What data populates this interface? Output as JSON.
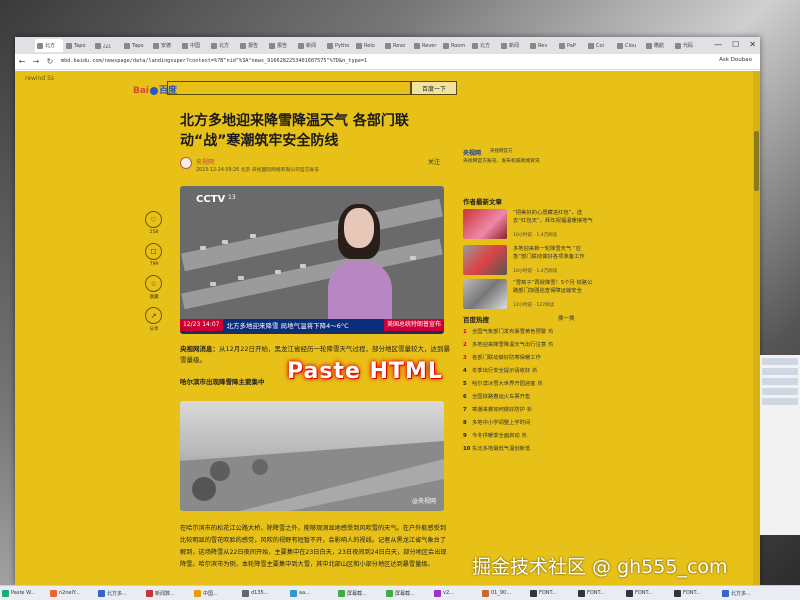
{
  "browser": {
    "tabs": [
      "北方",
      "Tapo",
      "¿¿¿",
      "Tapo",
      "安德",
      "中国",
      "北方",
      "报告",
      "报告",
      "新闻",
      "Pytho",
      "Relo",
      "Revo",
      "Rever",
      "Room",
      "北方",
      "新闻",
      "Rev",
      "PaP",
      "Coi",
      "Clou",
      "瞻航",
      "代码"
    ],
    "url": "mbd.baidu.com/newspage/data/landingsuper?context=%7B\"nid\"%3A\"news_9166282253401607575\"%7D&n_type=1",
    "ask_doubao": "Ask Doubao"
  },
  "page": {
    "rewind": "rewind 5s",
    "logo_text": "Bai",
    "logo_du": "百度",
    "search_button": "百度一下",
    "article": {
      "title": "北方多地迎来降雪降温天气 各部门联动“战”寒潮筑牢安全防线",
      "author": "央视网",
      "meta": "2023-12-24 09:26 北京 央视国际网络有限公司官方账号",
      "follow": "关注",
      "actions": [
        {
          "icon": "♡",
          "label": "258"
        },
        {
          "icon": "☐",
          "label": "799"
        },
        {
          "icon": "☆",
          "label": "收藏"
        },
        {
          "icon": "↗",
          "label": "分享"
        }
      ],
      "video": {
        "logo": "CCTV",
        "channel": "13",
        "ticker_time": "12/23 14:07",
        "ticker_text": "北方多地迎来降雪 局地气温将下降4～6°C",
        "ticker_right": "美国总统特朗普宣布"
      },
      "para1_lead": "央视网消息：",
      "para1": "从12月22日开始，黑龙江省经历一轮降雪天气过程，部分地区雪量较大，达到暴雪量级。",
      "subhead": "哈尔滨市出现降雪降主要集中",
      "image_watermark": "@央视网",
      "para2": "在哈尔滨市的松花江公路大桥，除降雪之外，能够观测显地感受到风吹雪的天气。在户外能感受到比较明显的雪花吹脸的感觉，风吹的视野有短暂不开，会影响人的视线。记者从黑龙江省气象台了解到，这场降雪从22日夜间开始，主要集中在23日白天，23日夜间到24日白天，部分地区会出现降雪。哈尔滨市为例，本轮降雪主要集中到大雪，其中北部山区和小部分地区达到暴雪量级。"
    },
    "sidebar": {
      "brand_name": "央视网",
      "brand_sub": "央视网官方",
      "brand_desc": "央视网官方账号，发布权威新闻资讯",
      "recent_title": "作者最新文章",
      "recent": [
        {
          "title": "“把美好的心愿藏进红包”，送去“红包天”，拜年祝福温暖接地气",
          "stats": "10小时前 · 1.4万阅读"
        },
        {
          "title": "多地迎来新一轮降雪天气 “应急”部门联动做好各项准备工作",
          "stats": "10小时前 · 1.4万阅读"
        },
        {
          "title": "“雪窝子”再掀降雪！5个月 铁路公路部门加强巡查保障运输安全",
          "stats": "12小时前 · 127阅读"
        }
      ],
      "hot_title": "百度热搜",
      "hot_refresh": "换一换",
      "hot": [
        {
          "n": "1",
          "text": "全国气象部门发布暴雪黄色预警",
          "badge": "热"
        },
        {
          "n": "2",
          "text": "多地迎来降雪降温天气出行注意",
          "badge": "热"
        },
        {
          "n": "3",
          "text": "各部门联动做好防寒保暖工作",
          "badge": ""
        },
        {
          "n": "4",
          "text": "冬季出行安全提示请收好",
          "badge": "新"
        },
        {
          "n": "5",
          "text": "哈尔滨冰雪大世界开园迎客",
          "badge": "热"
        },
        {
          "n": "6",
          "text": "全国铁路春运火车票开售",
          "badge": ""
        },
        {
          "n": "7",
          "text": "寒潮来袭如何做好防护",
          "badge": "新"
        },
        {
          "n": "8",
          "text": "多地中小学调整上学时间",
          "badge": ""
        },
        {
          "n": "9",
          "text": "今冬供暖季全面启动",
          "badge": "热"
        },
        {
          "n": "10",
          "text": "东北多地最低气温创新低",
          "badge": ""
        }
      ]
    },
    "overlay": "Paste HTML"
  },
  "taskbar": {
    "items": [
      "Paste W...",
      "n2nelY...",
      "北方多...",
      "新闻数...",
      "中国...",
      "d135...",
      "aa...",
      "屏幕截...",
      "屏幕截...",
      "v2...",
      "01_90...",
      "FONT...",
      "FONT...",
      "FONT...",
      "FONT...",
      "北方多..."
    ]
  },
  "watermark": "掘金技术社区 @ gh555_com",
  "colors": {
    "page_bg": "#e7c117",
    "brand_blue": "#2a55c8",
    "ticker_blue": "#0a2d7a",
    "alert_red": "#c03"
  }
}
